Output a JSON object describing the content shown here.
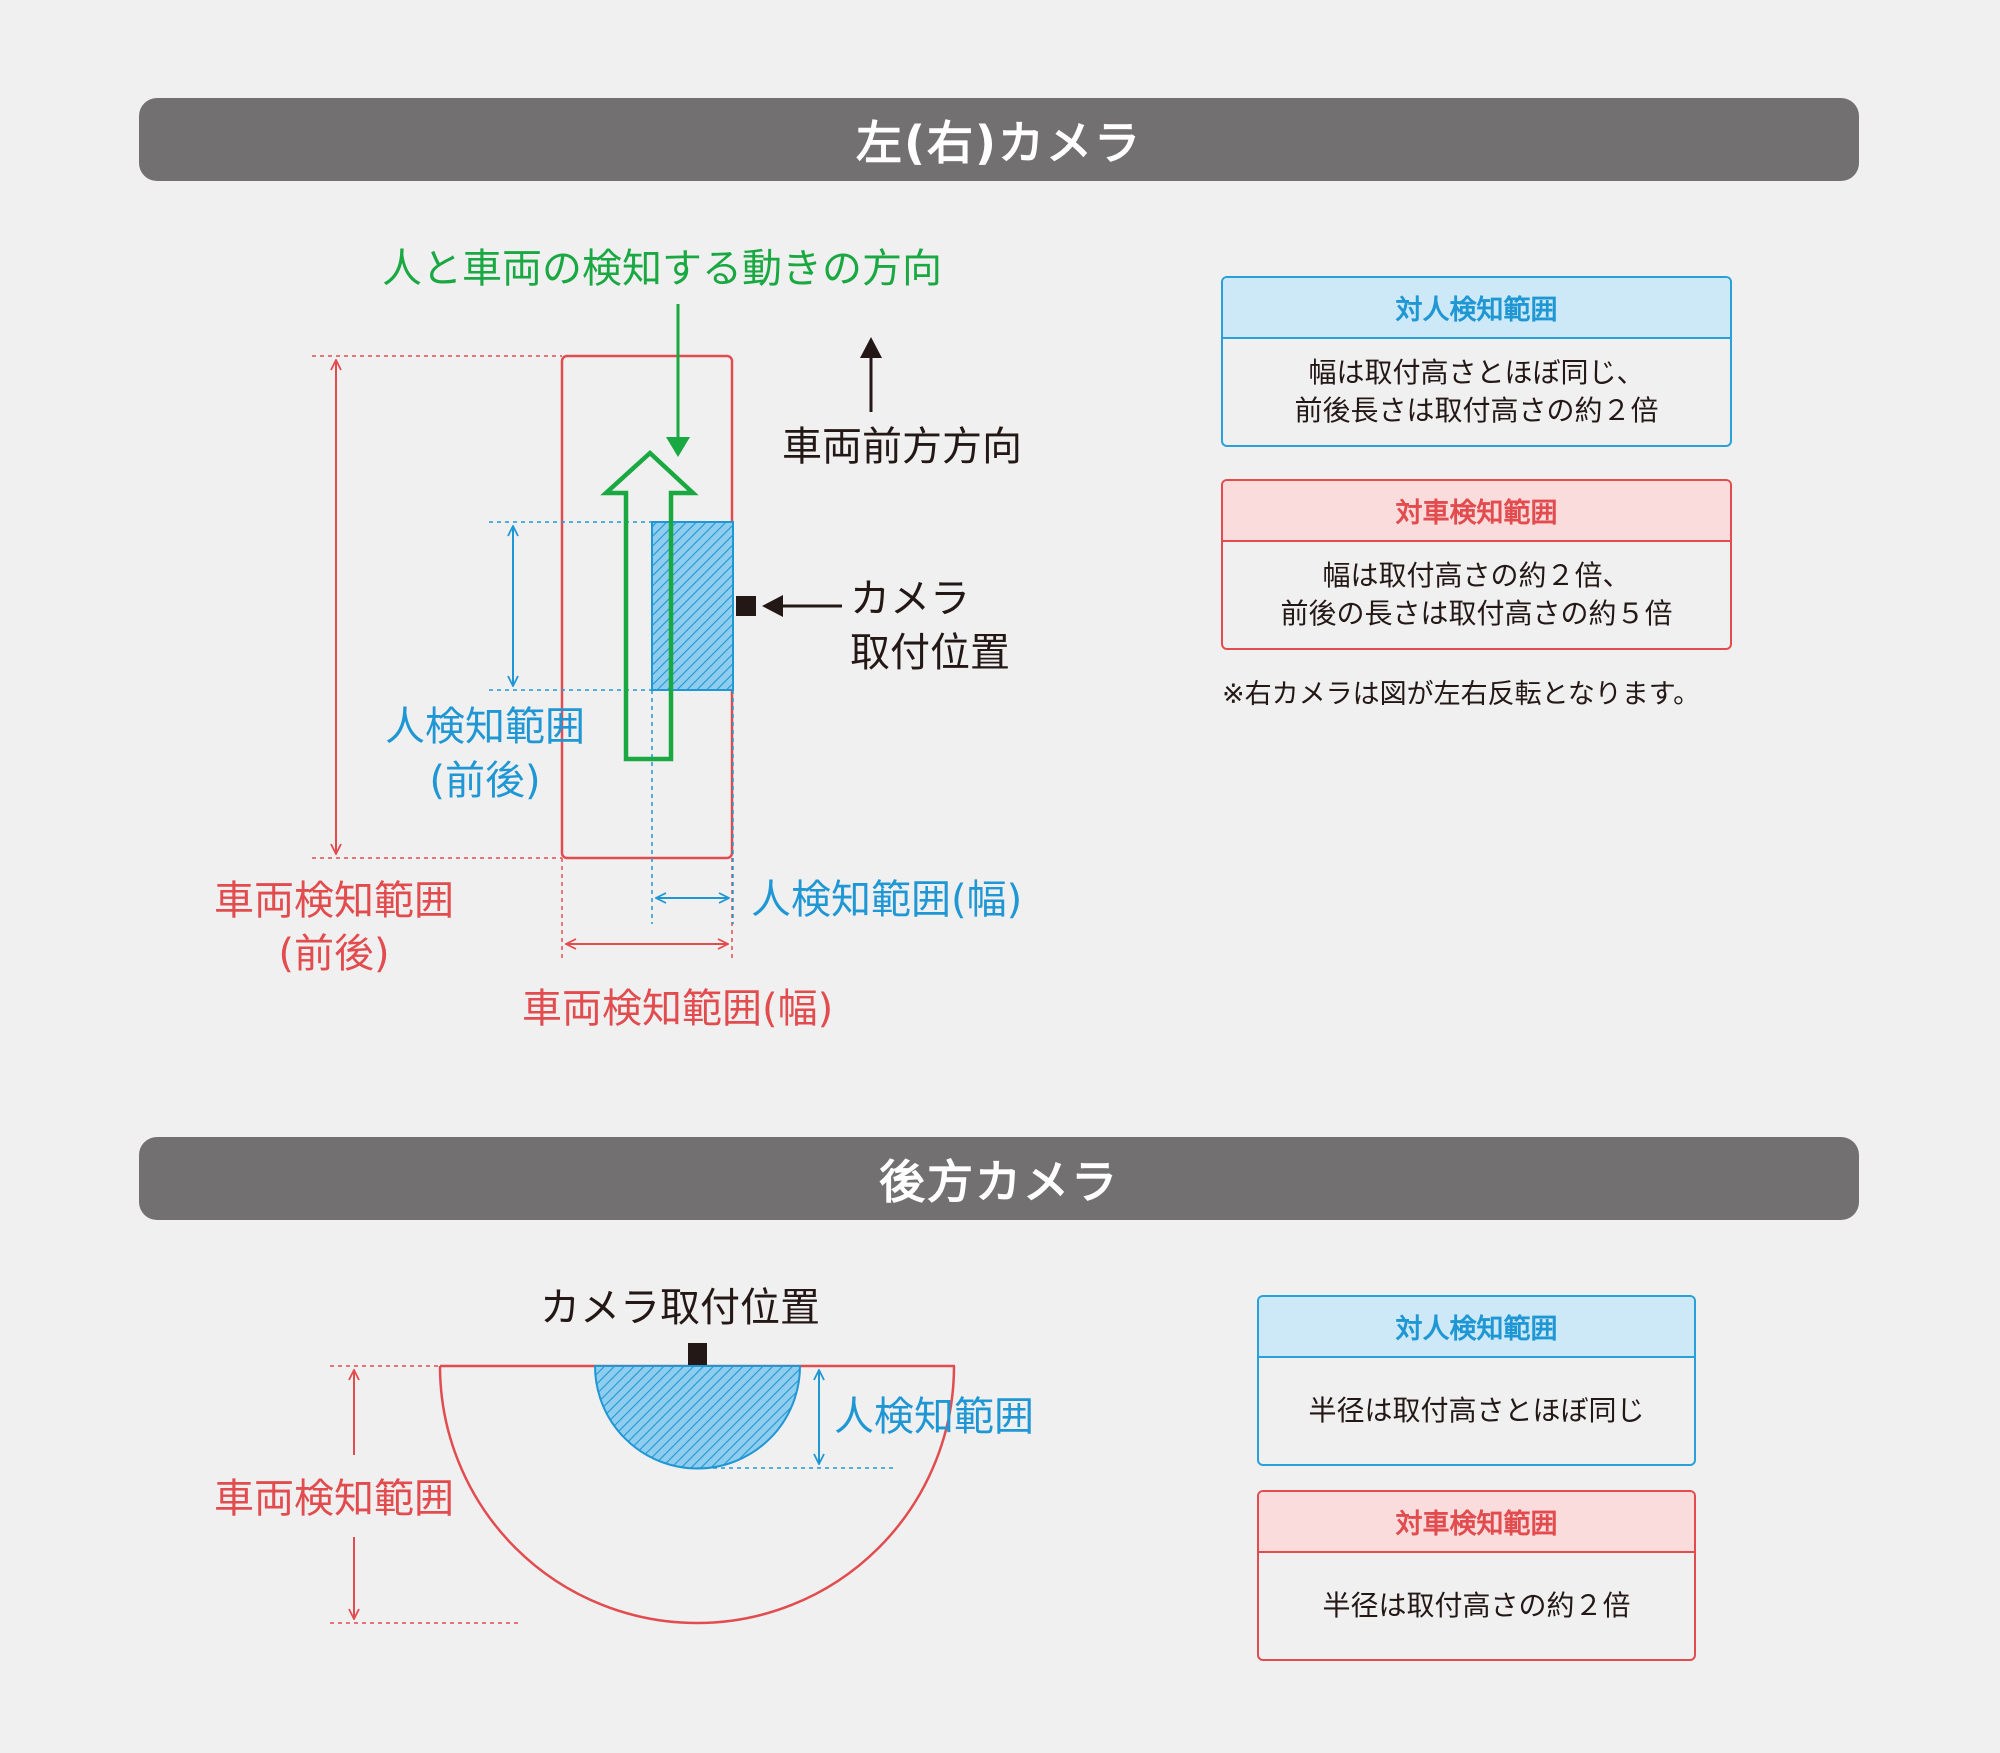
{
  "sections": {
    "side_camera": {
      "title": "左(右)カメラ",
      "labels": {
        "movement_direction": "人と車両の検知する動きの方向",
        "vehicle_forward": "車両前方方向",
        "camera_mount_line1": "カメラ",
        "camera_mount_line2": "取付位置",
        "person_range_front_line1": "人検知範囲",
        "person_range_front_line2": "(前後)",
        "vehicle_range_front_line1": "車両検知範囲",
        "vehicle_range_front_line2": "(前後)",
        "person_range_width": "人検知範囲(幅)",
        "vehicle_range_width": "車両検知範囲(幅)"
      },
      "person_box": {
        "header": "対人検知範囲",
        "line1": "幅は取付高さとほぼ同じ、",
        "line2": "前後長さは取付高さの約２倍"
      },
      "vehicle_box": {
        "header": "対車検知範囲",
        "line1": "幅は取付高さの約２倍、",
        "line2": "前後の長さは取付高さの約５倍"
      },
      "note": "※右カメラは図が左右反転となります。"
    },
    "rear_camera": {
      "title": "後方カメラ",
      "labels": {
        "camera_mount": "カメラ取付位置",
        "person_range": "人検知範囲",
        "vehicle_range": "車両検知範囲"
      },
      "person_box": {
        "header": "対人検知範囲",
        "line1": "半径は取付高さとほぼ同じ"
      },
      "vehicle_box": {
        "header": "対車検知範囲",
        "line1": "半径は取付高さの約２倍"
      }
    }
  },
  "colors": {
    "person": "#1f97d4",
    "vehicle": "#e24c4f",
    "movement": "#1aa842",
    "banner": "#727071",
    "text": "#231815"
  }
}
